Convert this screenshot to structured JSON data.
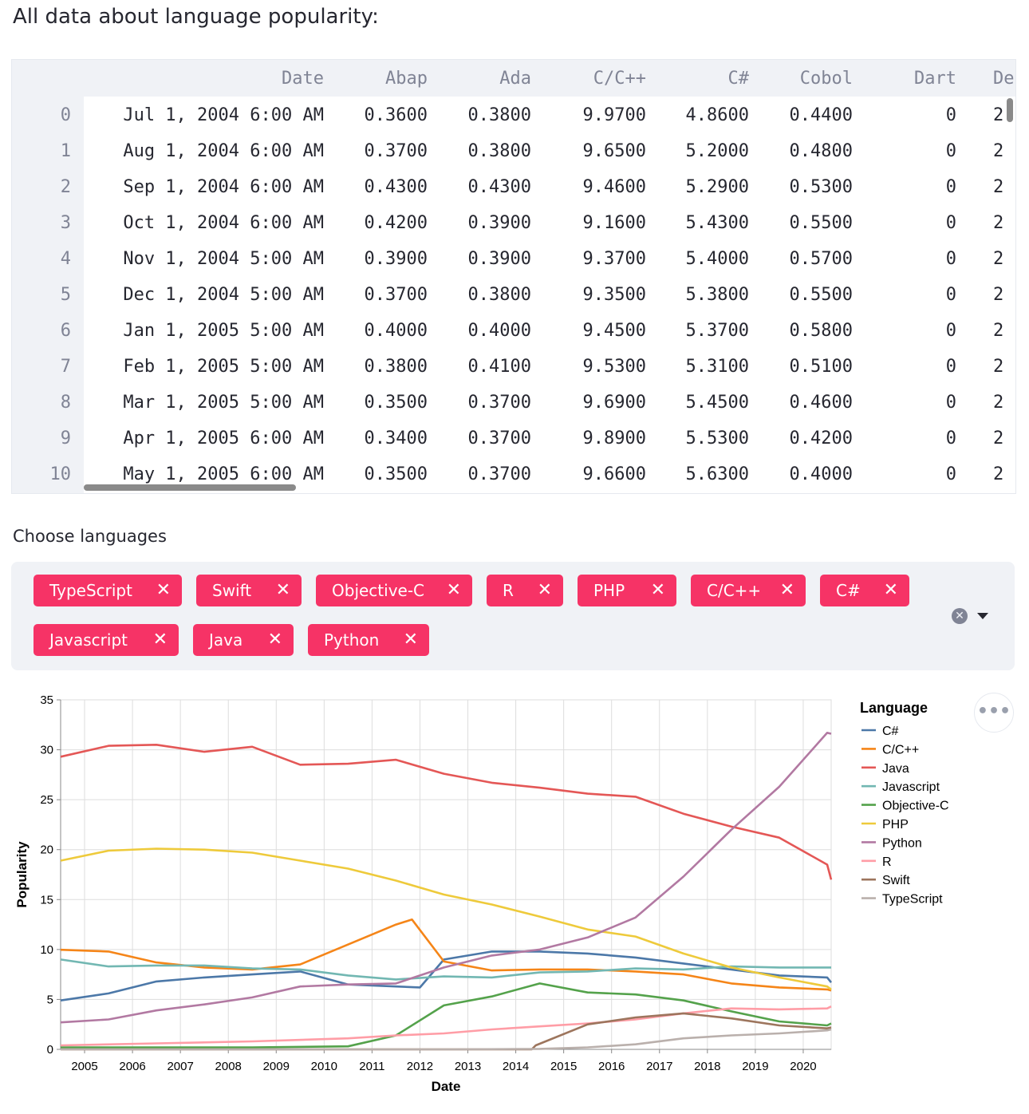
{
  "heading": "All data about language popularity:",
  "table": {
    "columns": [
      "Date",
      "Abap",
      "Ada",
      "C/C++",
      "C#",
      "Cobol",
      "Dart",
      "De"
    ],
    "rows": [
      {
        "index": "0",
        "cells": [
          "Jul 1, 2004 6:00 AM",
          "0.3600",
          "0.3800",
          "9.9700",
          "4.8600",
          "0.4400",
          "0",
          "2"
        ]
      },
      {
        "index": "1",
        "cells": [
          "Aug 1, 2004 6:00 AM",
          "0.3700",
          "0.3800",
          "9.6500",
          "5.2000",
          "0.4800",
          "0",
          "2"
        ]
      },
      {
        "index": "2",
        "cells": [
          "Sep 1, 2004 6:00 AM",
          "0.4300",
          "0.4300",
          "9.4600",
          "5.2900",
          "0.5300",
          "0",
          "2"
        ]
      },
      {
        "index": "3",
        "cells": [
          "Oct 1, 2004 6:00 AM",
          "0.4200",
          "0.3900",
          "9.1600",
          "5.4300",
          "0.5500",
          "0",
          "2"
        ]
      },
      {
        "index": "4",
        "cells": [
          "Nov 1, 2004 5:00 AM",
          "0.3900",
          "0.3900",
          "9.3700",
          "5.4000",
          "0.5700",
          "0",
          "2"
        ]
      },
      {
        "index": "5",
        "cells": [
          "Dec 1, 2004 5:00 AM",
          "0.3700",
          "0.3800",
          "9.3500",
          "5.3800",
          "0.5500",
          "0",
          "2"
        ]
      },
      {
        "index": "6",
        "cells": [
          "Jan 1, 2005 5:00 AM",
          "0.4000",
          "0.4000",
          "9.4500",
          "5.3700",
          "0.5800",
          "0",
          "2"
        ]
      },
      {
        "index": "7",
        "cells": [
          "Feb 1, 2005 5:00 AM",
          "0.3800",
          "0.4100",
          "9.5300",
          "5.3100",
          "0.5100",
          "0",
          "2"
        ]
      },
      {
        "index": "8",
        "cells": [
          "Mar 1, 2005 5:00 AM",
          "0.3500",
          "0.3700",
          "9.6900",
          "5.4500",
          "0.4600",
          "0",
          "2"
        ]
      },
      {
        "index": "9",
        "cells": [
          "Apr 1, 2005 6:00 AM",
          "0.3400",
          "0.3700",
          "9.8900",
          "5.5300",
          "0.4200",
          "0",
          "2"
        ]
      },
      {
        "index": "10",
        "cells": [
          "May 1, 2005 6:00 AM",
          "0.3500",
          "0.3700",
          "9.6600",
          "5.6300",
          "0.4000",
          "0",
          "2"
        ]
      }
    ]
  },
  "multiselect": {
    "label": "Choose languages",
    "remove_glyph": "✕",
    "clear_glyph": "✕",
    "selected": [
      "TypeScript",
      "Swift",
      "Objective-C",
      "R",
      "PHP",
      "C/C++",
      "C#",
      "Javascript",
      "Java",
      "Python"
    ],
    "tag_color": "#f63366"
  },
  "chart_menu_glyph": "•••",
  "chart_data": {
    "type": "line",
    "xlabel": "Date",
    "ylabel": "Popularity",
    "x_ticks": [
      "2005",
      "2006",
      "2007",
      "2008",
      "2009",
      "2010",
      "2011",
      "2012",
      "2013",
      "2014",
      "2015",
      "2016",
      "2017",
      "2018",
      "2019",
      "2020"
    ],
    "y_ticks": [
      "0",
      "5",
      "10",
      "15",
      "20",
      "25",
      "30",
      "35"
    ],
    "ylim": [
      0,
      35
    ],
    "xlim": [
      "2004-07",
      "2020-08"
    ],
    "grid": true,
    "legend_title": "Language",
    "legend_position": "right",
    "series": [
      {
        "name": "C#",
        "color": "#4c78a8",
        "x": [
          "2004-07",
          "2005-07",
          "2006-07",
          "2007-07",
          "2008-07",
          "2009-07",
          "2010-07",
          "2011-07",
          "2012-01",
          "2012-07",
          "2013-07",
          "2014-07",
          "2015-07",
          "2016-07",
          "2017-07",
          "2018-07",
          "2019-07",
          "2020-07",
          "2020-08"
        ],
        "y": [
          4.9,
          5.6,
          6.8,
          7.2,
          7.5,
          7.8,
          6.5,
          6.3,
          6.2,
          9.0,
          9.8,
          9.8,
          9.6,
          9.2,
          8.6,
          8.0,
          7.4,
          7.2,
          6.7
        ]
      },
      {
        "name": "C/C++",
        "color": "#f58518",
        "x": [
          "2004-07",
          "2005-07",
          "2006-07",
          "2007-07",
          "2008-07",
          "2009-07",
          "2010-07",
          "2011-07",
          "2011-11",
          "2012-07",
          "2013-07",
          "2014-07",
          "2015-07",
          "2016-07",
          "2017-07",
          "2018-07",
          "2019-07",
          "2020-07",
          "2020-08"
        ],
        "y": [
          9.97,
          9.8,
          8.7,
          8.2,
          8.0,
          8.5,
          10.5,
          12.5,
          13.0,
          8.8,
          7.9,
          8.0,
          8.0,
          7.8,
          7.5,
          6.6,
          6.2,
          6.0,
          5.9
        ]
      },
      {
        "name": "Java",
        "color": "#e45756",
        "x": [
          "2004-07",
          "2005-07",
          "2006-07",
          "2007-07",
          "2008-07",
          "2009-07",
          "2010-07",
          "2011-07",
          "2012-07",
          "2013-07",
          "2014-07",
          "2015-07",
          "2016-07",
          "2017-07",
          "2018-07",
          "2019-07",
          "2020-07",
          "2020-08"
        ],
        "y": [
          29.3,
          30.4,
          30.5,
          29.8,
          30.3,
          28.5,
          28.6,
          29.0,
          27.6,
          26.7,
          26.2,
          25.6,
          25.3,
          23.6,
          22.3,
          21.2,
          18.5,
          17.0
        ]
      },
      {
        "name": "Javascript",
        "color": "#72b7b2",
        "x": [
          "2004-07",
          "2005-07",
          "2006-07",
          "2007-07",
          "2008-07",
          "2009-07",
          "2010-07",
          "2011-07",
          "2012-07",
          "2013-07",
          "2014-07",
          "2015-07",
          "2016-07",
          "2017-07",
          "2018-07",
          "2019-07",
          "2020-07",
          "2020-08"
        ],
        "y": [
          9.0,
          8.3,
          8.4,
          8.4,
          8.1,
          8.0,
          7.4,
          7.0,
          7.3,
          7.2,
          7.7,
          7.8,
          8.1,
          8.0,
          8.3,
          8.2,
          8.2,
          8.2
        ]
      },
      {
        "name": "Objective-C",
        "color": "#54a24b",
        "x": [
          "2004-07",
          "2006-07",
          "2008-07",
          "2010-07",
          "2011-07",
          "2012-07",
          "2013-07",
          "2014-07",
          "2015-07",
          "2016-07",
          "2017-07",
          "2018-07",
          "2019-07",
          "2020-07",
          "2020-08"
        ],
        "y": [
          0.2,
          0.2,
          0.2,
          0.3,
          1.4,
          4.4,
          5.3,
          6.6,
          5.7,
          5.5,
          4.9,
          3.8,
          2.8,
          2.4,
          2.6
        ]
      },
      {
        "name": "PHP",
        "color": "#eeca3b",
        "x": [
          "2004-07",
          "2005-07",
          "2006-07",
          "2007-07",
          "2008-07",
          "2009-07",
          "2010-07",
          "2011-07",
          "2012-07",
          "2013-07",
          "2014-07",
          "2015-07",
          "2016-07",
          "2017-07",
          "2018-07",
          "2019-07",
          "2020-07",
          "2020-08"
        ],
        "y": [
          18.9,
          19.9,
          20.1,
          20.0,
          19.7,
          18.9,
          18.1,
          16.9,
          15.5,
          14.5,
          13.3,
          12.0,
          11.3,
          9.6,
          8.2,
          7.2,
          6.3,
          6.0
        ]
      },
      {
        "name": "Python",
        "color": "#b279a2",
        "x": [
          "2004-07",
          "2005-07",
          "2006-07",
          "2007-07",
          "2008-07",
          "2009-07",
          "2010-07",
          "2011-07",
          "2012-07",
          "2013-07",
          "2014-07",
          "2015-07",
          "2016-07",
          "2017-07",
          "2018-07",
          "2019-07",
          "2020-07",
          "2020-08"
        ],
        "y": [
          2.7,
          3.0,
          3.9,
          4.5,
          5.2,
          6.3,
          6.5,
          6.6,
          8.2,
          9.4,
          10.0,
          11.2,
          13.2,
          17.3,
          22.0,
          26.3,
          31.7,
          31.6
        ]
      },
      {
        "name": "R",
        "color": "#ff9da6",
        "x": [
          "2004-07",
          "2006-07",
          "2008-07",
          "2010-07",
          "2011-07",
          "2012-07",
          "2013-07",
          "2014-07",
          "2015-07",
          "2016-07",
          "2017-07",
          "2018-07",
          "2019-07",
          "2020-07",
          "2020-08"
        ],
        "y": [
          0.4,
          0.6,
          0.8,
          1.1,
          1.4,
          1.6,
          2.0,
          2.3,
          2.6,
          3.0,
          3.6,
          4.1,
          4.0,
          4.1,
          4.3
        ]
      },
      {
        "name": "Swift",
        "color": "#9d755d",
        "x": [
          "2004-07",
          "2014-05",
          "2014-06",
          "2015-07",
          "2016-07",
          "2017-07",
          "2018-07",
          "2019-07",
          "2020-07",
          "2020-08"
        ],
        "y": [
          0,
          0,
          0.4,
          2.5,
          3.2,
          3.6,
          3.1,
          2.4,
          2.1,
          2.2
        ]
      },
      {
        "name": "TypeScript",
        "color": "#bab0ac",
        "x": [
          "2004-07",
          "2012-10",
          "2014-07",
          "2015-07",
          "2016-07",
          "2017-07",
          "2018-07",
          "2019-07",
          "2020-07",
          "2020-08"
        ],
        "y": [
          0,
          0,
          0.05,
          0.2,
          0.5,
          1.1,
          1.4,
          1.6,
          1.9,
          2.0
        ]
      }
    ]
  }
}
